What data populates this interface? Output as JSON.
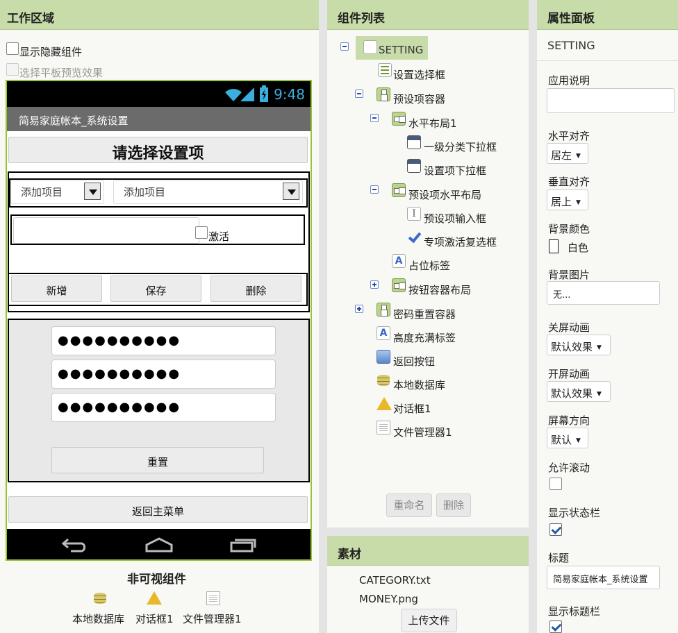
{
  "workspace": {
    "header": "工作区域",
    "show_hidden_label": "显示隐藏组件",
    "tablet_preview_label": "选择平板预览效果",
    "phone": {
      "clock": "9:48",
      "app_title": "简易家庭帐本_系统设置",
      "heading_button": "请选择设置项",
      "spinner1_value": "添加项目",
      "spinner2_value": "添加项目",
      "activate_label": "激活",
      "add_button": "新增",
      "save_button": "保存",
      "delete_button": "删除",
      "password1": "●●●●●●●●●●",
      "password2": "●●●●●●●●●●",
      "password3": "●●●●●●●●●●",
      "reset_button": "重置",
      "back_button": "返回主菜单"
    },
    "nonvisible_title": "非可视组件",
    "nonvisible": [
      {
        "icon": "database-icon",
        "label": "本地数据库"
      },
      {
        "icon": "warning-icon",
        "label": "对话框1"
      },
      {
        "icon": "file-icon",
        "label": "文件管理器1"
      }
    ]
  },
  "components": {
    "header": "组件列表",
    "tree": [
      {
        "label": "SETTING",
        "icon": "screen-icon"
      },
      {
        "label": "设置选择框",
        "icon": "list-icon"
      },
      {
        "label": "预设项容器",
        "icon": "vertical-arrangement-icon"
      },
      {
        "label": "水平布局1",
        "icon": "horizontal-arrangement-icon"
      },
      {
        "label": "一级分类下拉框",
        "icon": "spinner-icon"
      },
      {
        "label": "设置项下拉框",
        "icon": "spinner-icon"
      },
      {
        "label": "预设项水平布局",
        "icon": "horizontal-arrangement-icon"
      },
      {
        "label": "预设项输入框",
        "icon": "textbox-icon"
      },
      {
        "label": "专项激活复选框",
        "icon": "checkbox-icon"
      },
      {
        "label": "占位标签",
        "icon": "label-icon"
      },
      {
        "label": "按钮容器布局",
        "icon": "horizontal-arrangement-icon"
      },
      {
        "label": "密码重置容器",
        "icon": "vertical-arrangement-icon"
      },
      {
        "label": "高度充满标签",
        "icon": "label-icon"
      },
      {
        "label": "返回按钮",
        "icon": "button-icon"
      },
      {
        "label": "本地数据库",
        "icon": "database-icon"
      },
      {
        "label": "对话框1",
        "icon": "warning-icon"
      },
      {
        "label": "文件管理器1",
        "icon": "file-icon"
      }
    ],
    "rename_button": "重命名",
    "delete_button": "删除"
  },
  "media": {
    "header": "素材",
    "files": [
      "CATEGORY.txt",
      "MONEY.png"
    ],
    "upload_button": "上传文件"
  },
  "properties": {
    "header": "属性面板",
    "component_name": "SETTING",
    "app_description_label": "应用说明",
    "app_description_value": "",
    "align_horizontal_label": "水平对齐",
    "align_horizontal_value": "居左",
    "align_vertical_label": "垂直对齐",
    "align_vertical_value": "居上",
    "bg_color_label": "背景颜色",
    "bg_color_value": "白色",
    "bg_image_label": "背景图片",
    "bg_image_value": "无...",
    "close_anim_label": "关屏动画",
    "close_anim_value": "默认效果",
    "open_anim_label": "开屏动画",
    "open_anim_value": "默认效果",
    "orientation_label": "屏幕方向",
    "orientation_value": "默认",
    "scrollable_label": "允许滚动",
    "scrollable_checked": false,
    "show_status_bar_label": "显示状态栏",
    "show_status_bar_checked": true,
    "title_label": "标题",
    "title_value": "简易家庭帐本_系统设置",
    "show_title_bar_label": "显示标题栏",
    "show_title_bar_checked": true
  },
  "colors": {
    "header_bg": "#c8dcaa",
    "phone_border": "#98c434",
    "clock": "#3aaedc"
  }
}
